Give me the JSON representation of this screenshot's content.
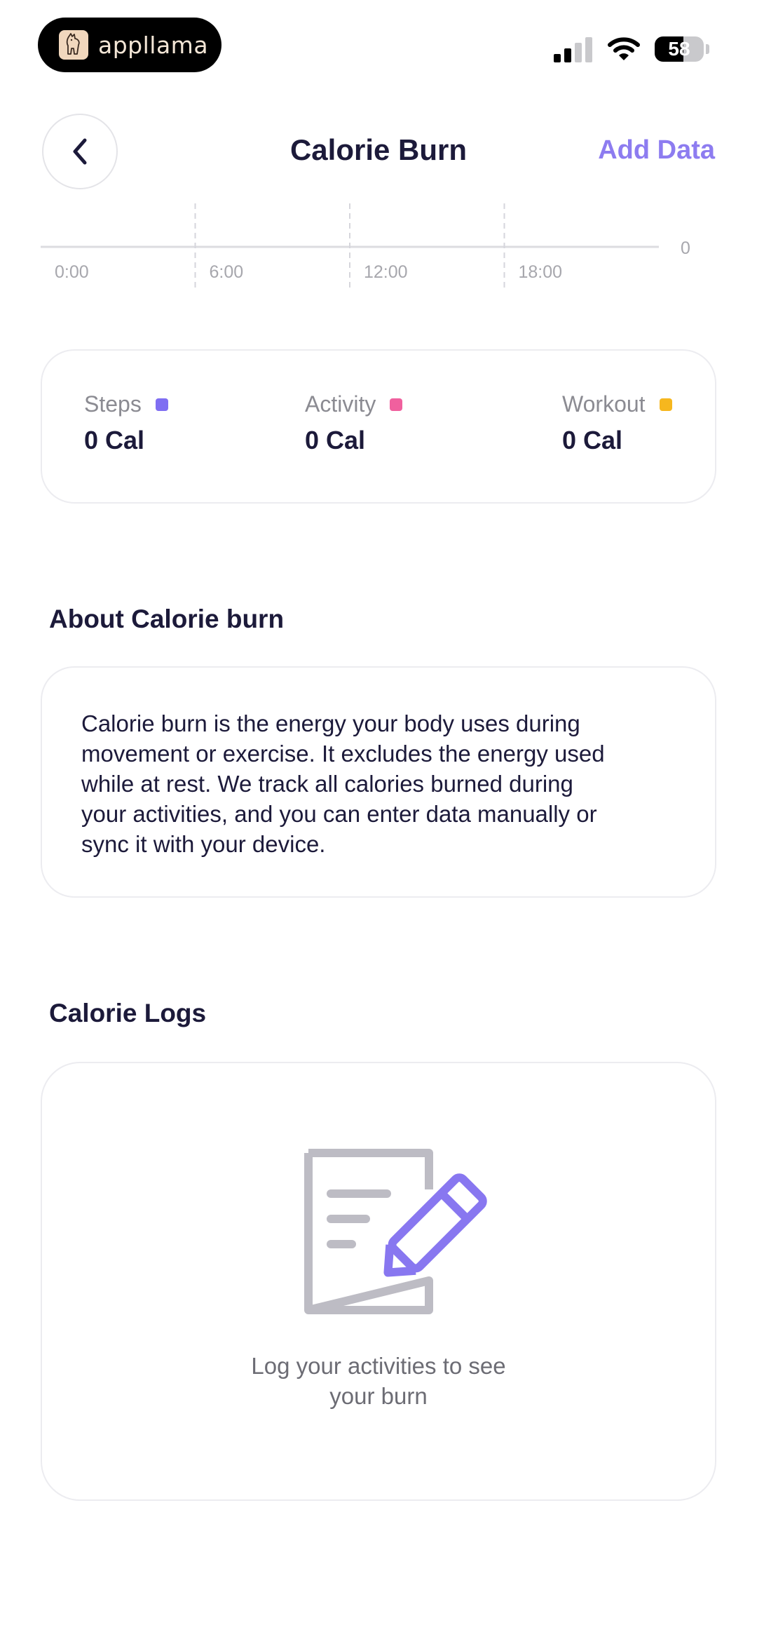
{
  "status_bar": {
    "app_name": "appllama",
    "battery_level": "58",
    "battery_fraction": 0.58
  },
  "header": {
    "title": "Calorie Burn",
    "back_icon": "chevron-left-icon",
    "add_data_label": "Add Data"
  },
  "chart_data": {
    "type": "bar",
    "categories": [
      "0:00",
      "6:00",
      "12:00",
      "18:00"
    ],
    "values": [
      0,
      0,
      0,
      0
    ],
    "y_tick": "0",
    "ylim": [
      0,
      0
    ],
    "grid": "vertical-dashed"
  },
  "summary": {
    "metrics": [
      {
        "label": "Steps",
        "value": "0 Cal",
        "color": "#7f6ef2"
      },
      {
        "label": "Activity",
        "value": "0 Cal",
        "color": "#f0609e"
      },
      {
        "label": "Workout",
        "value": "0 Cal",
        "color": "#f6b71e"
      }
    ]
  },
  "about": {
    "title": "About Calorie burn",
    "lines": [
      "Calorie burn is the energy your body uses during",
      "movement or exercise. It excludes the energy used",
      "while at rest. We track all calories burned during",
      "your activities, and you can enter data manually or",
      "sync it with your device."
    ]
  },
  "logs": {
    "title": "Calorie Logs",
    "empty_icon": "document-edit-icon",
    "empty_lines": [
      "Log your activities to see",
      "your burn"
    ]
  },
  "colors": {
    "accent": "#8d7cf0",
    "text_dark": "#1c1a3a",
    "text_muted": "#8b8b92",
    "icon_gray": "#bdbcc4"
  }
}
